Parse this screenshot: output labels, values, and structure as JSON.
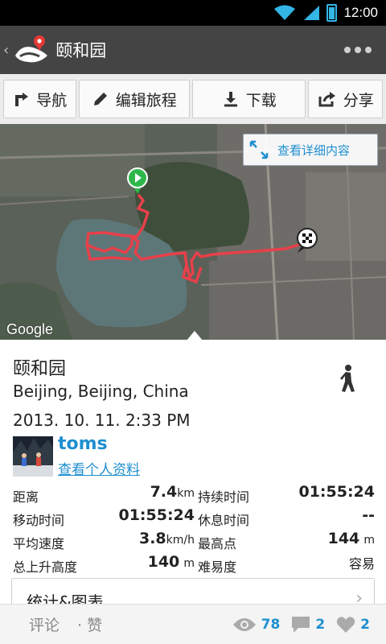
{
  "status_bar": {
    "time": "12:00"
  },
  "app_bar": {
    "back_glyph": "‹",
    "title": "颐和园",
    "logo_icon": "app-logo-icon",
    "overflow_icon": "overflow-menu-icon"
  },
  "toolbar": {
    "navigate_label": "导航",
    "edit_label": "编辑旅程",
    "download_label": "下载",
    "share_label": "分享"
  },
  "map": {
    "detail_label": "查看详细内容",
    "google_label": "Google",
    "route_color": "#e8404a",
    "start_marker_color": "#2eb84b"
  },
  "trip": {
    "title": "颐和园",
    "location": "Beijing, Beijing, China",
    "date": "2013. 10. 11. 2:33 PM",
    "activity_icon": "hiker-icon"
  },
  "user": {
    "name": "toms",
    "profile_link": "查看个人资料"
  },
  "stats": {
    "distance_label": "距离",
    "distance_value": "7.4",
    "distance_unit": "km",
    "duration_label": "持续时间",
    "duration_value": "01:55:24",
    "moving_label": "移动时间",
    "moving_value": "01:55:24",
    "rest_label": "休息时间",
    "rest_value": "--",
    "avg_speed_label": "平均速度",
    "avg_speed_value": "3.8",
    "avg_speed_unit": "km/h",
    "max_elev_label": "最高点",
    "max_elev_value": "144",
    "max_elev_unit": "m",
    "ascent_label": "总上升高度",
    "ascent_value": "140",
    "ascent_unit": "m",
    "difficulty_label": "难易度",
    "difficulty_value": "容易"
  },
  "stats_chart": {
    "label": "统计&图表",
    "chevron": "›"
  },
  "bottom_bar": {
    "comment_label": "评论",
    "like_label": "· 赞",
    "views": "78",
    "comments": "2",
    "likes": "2"
  },
  "colors": {
    "accent": "#1e8fd0",
    "action_bar": "#444444",
    "status_icon": "#33b5e5"
  }
}
